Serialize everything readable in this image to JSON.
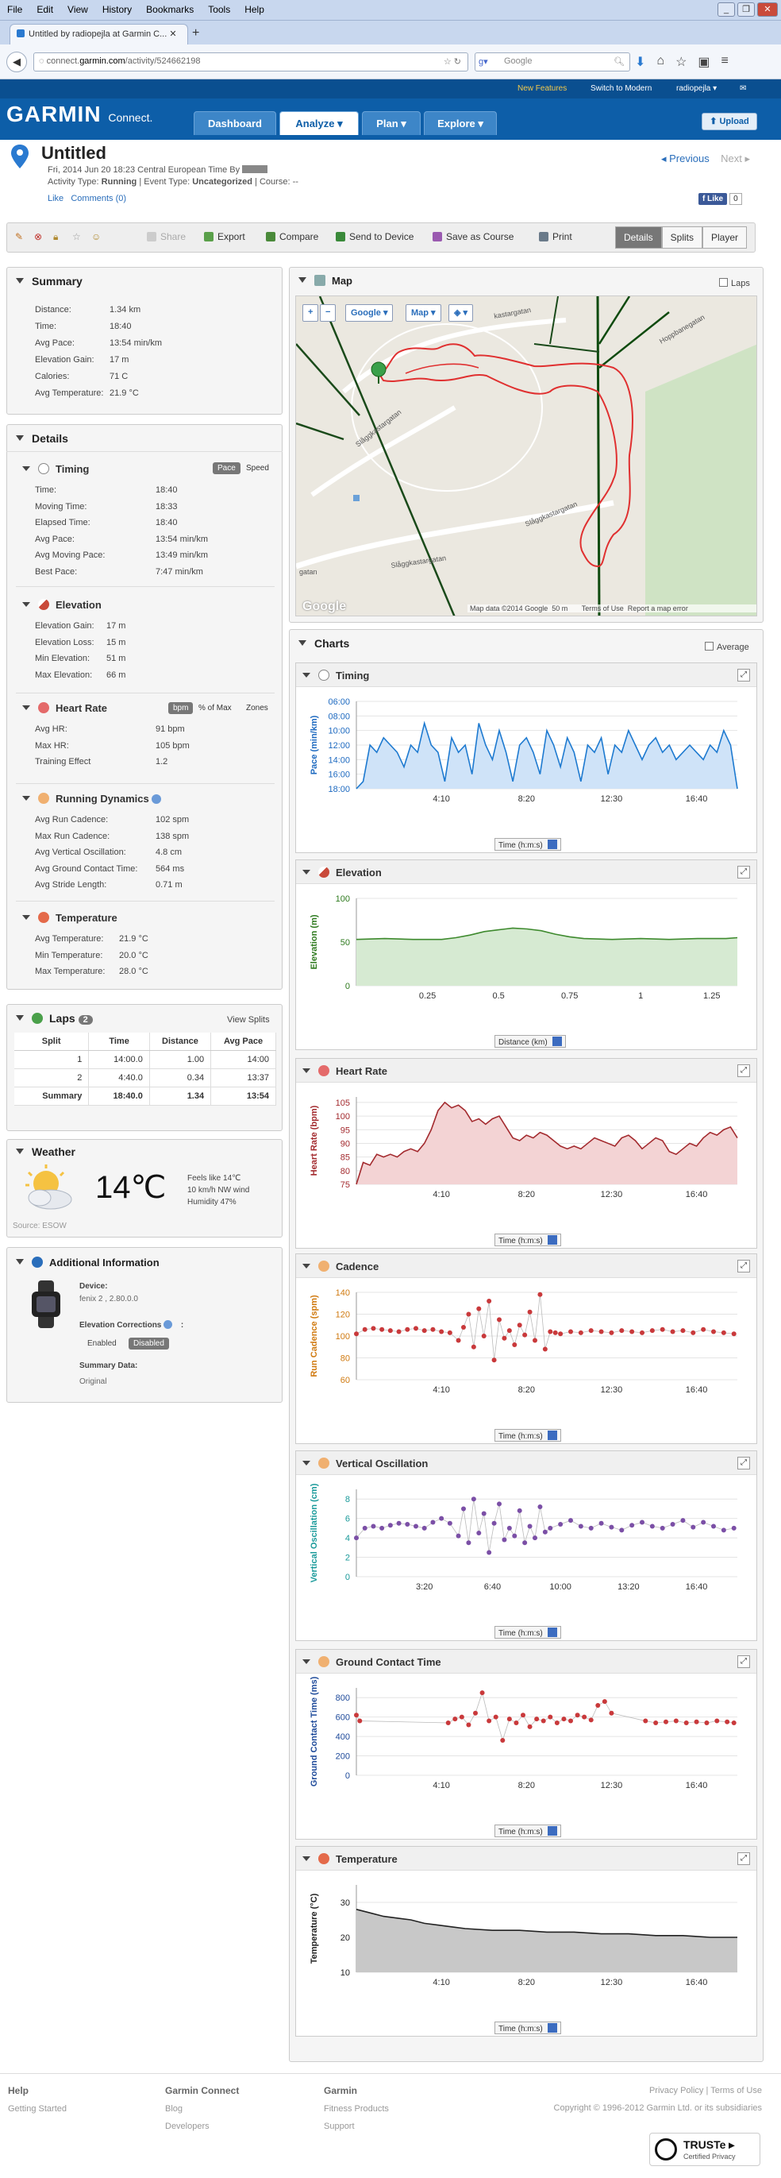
{
  "browser": {
    "menu": [
      "File",
      "Edit",
      "View",
      "History",
      "Bookmarks",
      "Tools",
      "Help"
    ],
    "tab_title": "Untitled by radiopejla at Garmin C...",
    "url_prefix": "connect.",
    "url_domain": "garmin.com",
    "url_path": "/activity/524662198",
    "search_engine": "Google",
    "search_placeholder": "Google"
  },
  "garmin": {
    "top_links": {
      "new_features": "New Features",
      "switch": "Switch to Modern",
      "user": "radiopejla ▾"
    },
    "logo": "GARMIN",
    "logo_sub": "Connect.",
    "nav": [
      "Dashboard",
      "Analyze ▾",
      "Plan ▾",
      "Explore ▾"
    ],
    "upload": "⬆ Upload"
  },
  "activity": {
    "title": "Untitled",
    "date_line": "Fri, 2014 Jun 20 18:23 Central European Time By",
    "type_label": "Activity Type:",
    "type_value": "Running",
    "event_label": "| Event Type:",
    "event_value": "Uncategorized",
    "course_label": "| Course: --",
    "like": "Like",
    "comments": "Comments (0)",
    "prev": "◂ Previous",
    "next": "Next ▸",
    "fb_like": "f Like",
    "fb_count": "0"
  },
  "toolbar": {
    "share": "Share",
    "export": "Export",
    "compare": "Compare",
    "send": "Send to Device",
    "save_course": "Save as Course",
    "print": "Print",
    "tabs": [
      "Details",
      "Splits",
      "Player"
    ]
  },
  "summary": {
    "title": "Summary",
    "rows": [
      {
        "k": "Distance:",
        "v": "1.34 km"
      },
      {
        "k": "Time:",
        "v": "18:40"
      },
      {
        "k": "Avg Pace:",
        "v": "13:54 min/km"
      },
      {
        "k": "Elevation Gain:",
        "v": "17 m"
      },
      {
        "k": "Calories:",
        "v": "71 C"
      },
      {
        "k": "Avg Temperature:",
        "v": "21.9 °C"
      }
    ]
  },
  "details": {
    "title": "Details",
    "timing": {
      "title": "Timing",
      "pace": "Pace",
      "speed": "Speed",
      "rows": [
        {
          "k": "Time:",
          "v": "18:40"
        },
        {
          "k": "Moving Time:",
          "v": "18:33"
        },
        {
          "k": "Elapsed Time:",
          "v": "18:40"
        },
        {
          "k": "Avg Pace:",
          "v": "13:54 min/km"
        },
        {
          "k": "Avg Moving Pace:",
          "v": "13:49 min/km"
        },
        {
          "k": "Best Pace:",
          "v": "7:47 min/km"
        }
      ]
    },
    "elevation": {
      "title": "Elevation",
      "rows": [
        {
          "k": "Elevation Gain:",
          "v": "17 m"
        },
        {
          "k": "Elevation Loss:",
          "v": "15 m"
        },
        {
          "k": "Min Elevation:",
          "v": "51 m"
        },
        {
          "k": "Max Elevation:",
          "v": "66 m"
        }
      ]
    },
    "heart_rate": {
      "title": "Heart Rate",
      "bpm": "bpm",
      "pct": "% of Max",
      "zones": "Zones",
      "rows": [
        {
          "k": "Avg HR:",
          "v": "91 bpm"
        },
        {
          "k": "Max HR:",
          "v": "105 bpm"
        },
        {
          "k": "Training Effect",
          "v": "1.2"
        }
      ]
    },
    "dynamics": {
      "title": "Running Dynamics",
      "rows": [
        {
          "k": "Avg Run Cadence:",
          "v": "102 spm"
        },
        {
          "k": "Max Run Cadence:",
          "v": "138 spm"
        },
        {
          "k": "Avg Vertical Oscillation:",
          "v": "4.8 cm"
        },
        {
          "k": "Avg Ground Contact Time:",
          "v": "564 ms"
        },
        {
          "k": "Avg Stride Length:",
          "v": "0.71 m"
        }
      ]
    },
    "temperature": {
      "title": "Temperature",
      "rows": [
        {
          "k": "Avg Temperature:",
          "v": "21.9 °C"
        },
        {
          "k": "Min Temperature:",
          "v": "20.0 °C"
        },
        {
          "k": "Max Temperature:",
          "v": "28.0 °C"
        }
      ]
    }
  },
  "laps": {
    "title": "Laps",
    "count": "2",
    "view_splits": "View Splits",
    "headers": [
      "Split",
      "Time",
      "Distance",
      "Avg Pace"
    ],
    "rows": [
      [
        "1",
        "14:00.0",
        "1.00",
        "14:00"
      ],
      [
        "2",
        "4:40.0",
        "0.34",
        "13:37"
      ]
    ],
    "summary": [
      "Summary",
      "18:40.0",
      "1.34",
      "13:54"
    ]
  },
  "weather": {
    "title": "Weather",
    "temp": "14℃",
    "feels": "Feels like 14℃",
    "wind": "10 km/h NW wind",
    "humidity": "Humidity 47%",
    "source": "Source: ESOW"
  },
  "additional": {
    "title": "Additional Information",
    "device_label": "Device:",
    "device": "fenix 2 , 2.80.0.0",
    "corrections": "Elevation Corrections",
    "enabled": "Enabled",
    "disabled": "Disabled",
    "summary_label": "Summary Data:",
    "summary_value": "Original"
  },
  "map": {
    "title": "Map",
    "laps": "Laps",
    "controls": [
      "+",
      "−",
      "Google ▾",
      "Map ▾",
      "◈ ▾"
    ],
    "streets": [
      "Slåggkastargatan",
      "Slåggkastargatan",
      "Slåggkastargatan",
      "Hoppbanegatan",
      "kastargatan",
      "gatan"
    ],
    "attribution": "Map data ©2014 Google",
    "scale": "50 m",
    "terms": "Terms of Use",
    "report": "Report a map error",
    "google": "Google"
  },
  "charts_section": {
    "title": "Charts",
    "average": "Average"
  },
  "chart_data": [
    {
      "type": "area",
      "title": "Timing",
      "ylabel": "Pace (min/km)",
      "unit_select": "Time (h:m:s)",
      "yticks": [
        "06:00",
        "08:00",
        "10:00",
        "12:00",
        "14:00",
        "16:00",
        "18:00"
      ],
      "ylim_minutes": [
        6,
        18
      ],
      "y_inverted": true,
      "xticks": [
        "4:10",
        "8:20",
        "12:30",
        "16:40"
      ],
      "xlim_seconds": [
        0,
        1120
      ],
      "x": [
        0,
        20,
        40,
        60,
        80,
        100,
        120,
        140,
        160,
        180,
        200,
        220,
        240,
        260,
        280,
        300,
        320,
        340,
        360,
        380,
        400,
        420,
        440,
        460,
        480,
        500,
        520,
        540,
        560,
        580,
        600,
        620,
        640,
        660,
        680,
        700,
        720,
        740,
        760,
        780,
        800,
        820,
        840,
        860,
        880,
        900,
        920,
        940,
        960,
        980,
        1000,
        1020,
        1040,
        1060,
        1080,
        1100,
        1120
      ],
      "values": [
        18,
        17,
        12,
        13,
        11,
        12,
        13,
        15,
        12,
        13,
        9,
        12,
        13,
        17,
        11,
        13,
        12,
        16,
        9,
        12,
        14,
        10,
        13,
        17,
        12,
        11,
        13,
        16,
        10,
        12,
        15,
        11,
        13,
        17,
        12,
        13,
        11,
        16,
        12,
        13,
        10,
        12,
        14,
        12,
        11,
        13,
        12,
        14,
        13,
        12,
        13,
        14,
        12,
        13,
        10,
        12,
        18
      ],
      "fill": "#cfe3f8",
      "stroke": "#1e7ad0"
    },
    {
      "type": "area",
      "title": "Elevation",
      "ylabel": "Elevation (m)",
      "unit_select": "Distance (km)",
      "yticks": [
        "0",
        "50",
        "100"
      ],
      "ylim": [
        0,
        100
      ],
      "xticks": [
        "0.25",
        "0.5",
        "0.75",
        "1",
        "1.25"
      ],
      "xlim": [
        0,
        1.34
      ],
      "x": [
        0,
        0.1,
        0.2,
        0.3,
        0.35,
        0.4,
        0.45,
        0.5,
        0.55,
        0.6,
        0.65,
        0.7,
        0.75,
        0.8,
        0.9,
        1.0,
        1.1,
        1.2,
        1.3,
        1.34
      ],
      "values": [
        53,
        54,
        53,
        53,
        55,
        58,
        62,
        64,
        66,
        65,
        63,
        59,
        56,
        54,
        53,
        54,
        53,
        54,
        54,
        55
      ],
      "fill": "#d6ead2",
      "stroke": "#3e8a2e"
    },
    {
      "type": "area",
      "title": "Heart Rate",
      "ylabel": "Heart Rate (bpm)",
      "unit_select": "Time (h:m:s)",
      "yticks": [
        "75",
        "80",
        "85",
        "90",
        "95",
        "100",
        "105"
      ],
      "ylim": [
        75,
        107
      ],
      "xticks": [
        "4:10",
        "8:20",
        "12:30",
        "16:40"
      ],
      "xlim_seconds": [
        0,
        1120
      ],
      "x": [
        0,
        20,
        40,
        60,
        80,
        100,
        120,
        140,
        160,
        180,
        200,
        220,
        240,
        260,
        280,
        300,
        320,
        340,
        360,
        380,
        400,
        420,
        440,
        460,
        480,
        500,
        520,
        540,
        560,
        580,
        600,
        620,
        640,
        660,
        680,
        700,
        720,
        740,
        760,
        780,
        800,
        820,
        840,
        860,
        880,
        900,
        920,
        940,
        960,
        980,
        1000,
        1020,
        1040,
        1060,
        1080,
        1100,
        1120
      ],
      "values": [
        75,
        83,
        82,
        86,
        85,
        86,
        85,
        87,
        88,
        87,
        90,
        95,
        102,
        105,
        103,
        104,
        102,
        98,
        99,
        97,
        99,
        100,
        96,
        92,
        91,
        93,
        92,
        94,
        93,
        91,
        89,
        88,
        89,
        88,
        90,
        92,
        91,
        90,
        89,
        92,
        93,
        91,
        88,
        90,
        92,
        91,
        87,
        86,
        88,
        90,
        89,
        92,
        94,
        93,
        95,
        96,
        92
      ],
      "fill": "#f3d3d4",
      "stroke": "#a32a2e"
    },
    {
      "type": "scatter",
      "title": "Cadence",
      "ylabel": "Run Cadence (spm)",
      "unit_select": "Time (h:m:s)",
      "yticks": [
        "60",
        "80",
        "100",
        "120",
        "140"
      ],
      "ylim": [
        60,
        140
      ],
      "xticks": [
        "4:10",
        "8:20",
        "12:30",
        "16:40"
      ],
      "xlim_seconds": [
        0,
        1120
      ],
      "x": [
        0,
        25,
        50,
        75,
        100,
        125,
        150,
        175,
        200,
        225,
        250,
        275,
        300,
        315,
        330,
        345,
        360,
        375,
        390,
        405,
        420,
        435,
        450,
        465,
        480,
        495,
        510,
        525,
        540,
        555,
        570,
        585,
        600,
        630,
        660,
        690,
        720,
        750,
        780,
        810,
        840,
        870,
        900,
        930,
        960,
        990,
        1020,
        1050,
        1080,
        1110
      ],
      "values": [
        102,
        106,
        107,
        106,
        105,
        104,
        106,
        107,
        105,
        106,
        104,
        103,
        96,
        108,
        120,
        90,
        125,
        100,
        132,
        78,
        115,
        98,
        105,
        92,
        110,
        101,
        122,
        96,
        138,
        88,
        104,
        103,
        102,
        104,
        103,
        105,
        104,
        103,
        105,
        104,
        103,
        105,
        106,
        104,
        105,
        103,
        106,
        104,
        103,
        102
      ],
      "color": "#c9393b"
    },
    {
      "type": "scatter",
      "title": "Vertical Oscillation",
      "ylabel": "Vertical Oscillation (cm)",
      "unit_select": "Time (h:m:s)",
      "yticks": [
        "0",
        "2",
        "4",
        "6",
        "8"
      ],
      "ylim": [
        0,
        9
      ],
      "xticks": [
        "3:20",
        "6:40",
        "10:00",
        "13:20",
        "16:40"
      ],
      "xlim_seconds": [
        0,
        1120
      ],
      "x": [
        0,
        25,
        50,
        75,
        100,
        125,
        150,
        175,
        200,
        225,
        250,
        275,
        300,
        315,
        330,
        345,
        360,
        375,
        390,
        405,
        420,
        435,
        450,
        465,
        480,
        495,
        510,
        525,
        540,
        555,
        570,
        600,
        630,
        660,
        690,
        720,
        750,
        780,
        810,
        840,
        870,
        900,
        930,
        960,
        990,
        1020,
        1050,
        1080,
        1110
      ],
      "values": [
        4.0,
        5.0,
        5.2,
        5.0,
        5.3,
        5.5,
        5.4,
        5.2,
        5.0,
        5.6,
        6.0,
        5.5,
        4.2,
        7.0,
        3.5,
        8.0,
        4.5,
        6.5,
        2.5,
        5.5,
        7.5,
        3.8,
        5.0,
        4.2,
        6.8,
        3.5,
        5.2,
        4.0,
        7.2,
        4.6,
        5.0,
        5.4,
        5.8,
        5.2,
        5.0,
        5.5,
        5.1,
        4.8,
        5.3,
        5.6,
        5.2,
        5.0,
        5.4,
        5.8,
        5.1,
        5.6,
        5.2,
        4.8,
        5.0
      ],
      "color": "#7b4fa6"
    },
    {
      "type": "scatter",
      "title": "Ground Contact Time",
      "ylabel": "Ground Contact Time (ms)",
      "unit_select": "Time (h:m:s)",
      "yticks": [
        "0",
        "200",
        "400",
        "600",
        "800"
      ],
      "ylim": [
        0,
        900
      ],
      "xticks": [
        "4:10",
        "8:20",
        "12:30",
        "16:40"
      ],
      "xlim_seconds": [
        0,
        1120
      ],
      "x": [
        0,
        10,
        270,
        290,
        310,
        330,
        350,
        370,
        390,
        410,
        430,
        450,
        470,
        490,
        510,
        530,
        550,
        570,
        590,
        610,
        630,
        650,
        670,
        690,
        710,
        730,
        750,
        850,
        880,
        910,
        940,
        970,
        1000,
        1030,
        1060,
        1090,
        1110
      ],
      "values": [
        620,
        560,
        540,
        580,
        600,
        520,
        640,
        850,
        560,
        600,
        360,
        580,
        540,
        620,
        500,
        580,
        560,
        600,
        540,
        580,
        560,
        620,
        600,
        570,
        720,
        760,
        640,
        560,
        540,
        550,
        560,
        540,
        550,
        540,
        560,
        550,
        540
      ],
      "color": "#c9393b"
    },
    {
      "type": "area",
      "title": "Temperature",
      "ylabel": "Temperature (°C)",
      "unit_select": "Time (h:m:s)",
      "yticks": [
        "10",
        "20",
        "30"
      ],
      "ylim": [
        10,
        35
      ],
      "xticks": [
        "4:10",
        "8:20",
        "12:30",
        "16:40"
      ],
      "xlim_seconds": [
        0,
        1120
      ],
      "x": [
        0,
        40,
        80,
        120,
        160,
        200,
        240,
        280,
        320,
        400,
        480,
        560,
        640,
        720,
        800,
        880,
        960,
        1040,
        1120
      ],
      "values": [
        28,
        27,
        26,
        25.5,
        25,
        24,
        23.5,
        23,
        22.5,
        22,
        22,
        21.5,
        21.5,
        21,
        21,
        20.5,
        20.5,
        20,
        20
      ],
      "fill": "#c8c8c8",
      "stroke": "#222"
    }
  ],
  "footer": {
    "help": "Help",
    "getting_started": "Getting Started",
    "gc": "Garmin Connect",
    "blog": "Blog",
    "developers": "Developers",
    "garmin": "Garmin",
    "fitness": "Fitness Products",
    "support": "Support",
    "policy": "Privacy Policy | Terms of Use",
    "copyright": "Copyright © 1996-2012 Garmin Ltd. or its subsidiaries",
    "truste": "TRUSTe ▸",
    "truste_sub": "Certified Privacy"
  }
}
